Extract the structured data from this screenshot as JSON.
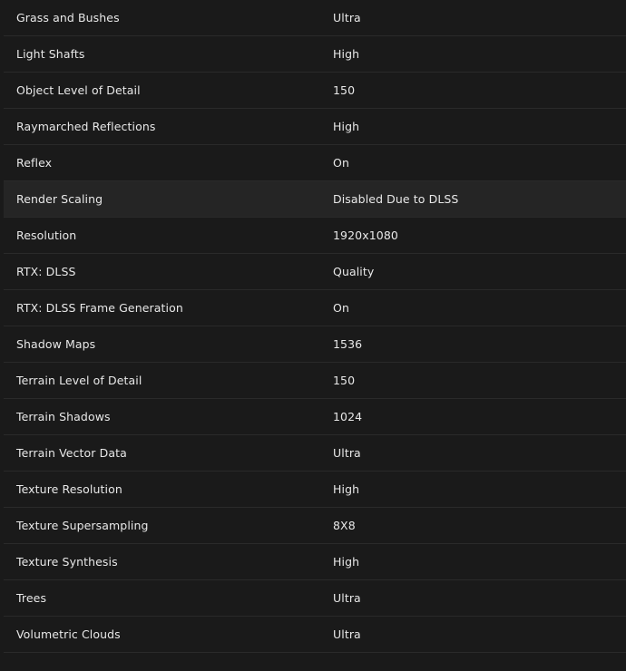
{
  "settings": [
    {
      "name": "Grass and Bushes",
      "value": "Ultra"
    },
    {
      "name": "Light Shafts",
      "value": "High"
    },
    {
      "name": "Object Level of Detail",
      "value": "150"
    },
    {
      "name": "Raymarched Reflections",
      "value": "High"
    },
    {
      "name": "Reflex",
      "value": "On"
    },
    {
      "name": "Render Scaling",
      "value": "Disabled Due to DLSS"
    },
    {
      "name": "Resolution",
      "value": "1920x1080"
    },
    {
      "name": "RTX: DLSS",
      "value": "Quality"
    },
    {
      "name": "RTX: DLSS Frame Generation",
      "value": "On"
    },
    {
      "name": "Shadow Maps",
      "value": "1536"
    },
    {
      "name": "Terrain Level of Detail",
      "value": "150"
    },
    {
      "name": "Terrain Shadows",
      "value": "1024"
    },
    {
      "name": "Terrain Vector Data",
      "value": "Ultra"
    },
    {
      "name": "Texture Resolution",
      "value": "High"
    },
    {
      "name": "Texture Supersampling",
      "value": "8X8"
    },
    {
      "name": "Texture Synthesis",
      "value": "High"
    },
    {
      "name": "Trees",
      "value": "Ultra"
    },
    {
      "name": "Volumetric Clouds",
      "value": "Ultra"
    }
  ],
  "colors": {
    "background": "#1a1a1a",
    "row_highlight": "#252525",
    "divider": "#2a2a2a",
    "text": "#e8e8e8"
  }
}
